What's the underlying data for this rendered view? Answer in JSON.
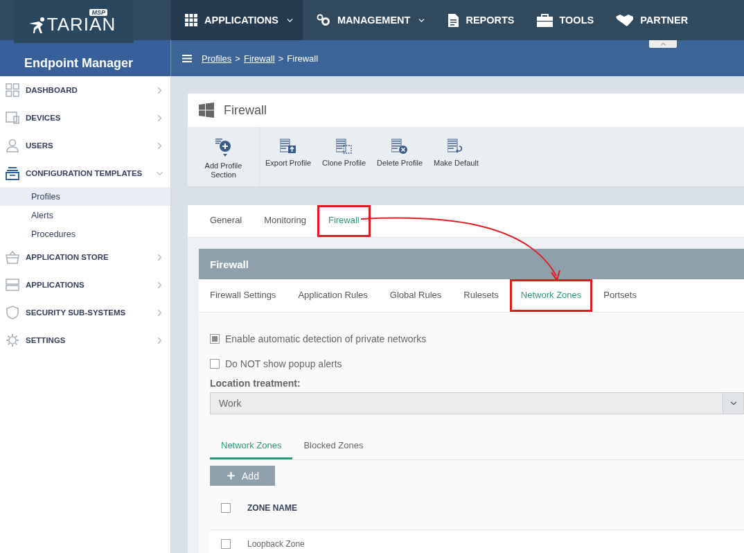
{
  "top_nav": {
    "logo": {
      "name": "TARIAN",
      "badge": "MSP"
    },
    "items": [
      {
        "label": "APPLICATIONS",
        "dropdown": true,
        "selected": true
      },
      {
        "label": "MANAGEMENT",
        "dropdown": true,
        "selected": false
      },
      {
        "label": "REPORTS",
        "dropdown": false,
        "selected": false
      },
      {
        "label": "TOOLS",
        "dropdown": false,
        "selected": false
      },
      {
        "label": "PARTNER",
        "dropdown": false,
        "selected": false
      }
    ]
  },
  "sidebar": {
    "title": "Endpoint Manager",
    "items": [
      {
        "label": "DASHBOARD",
        "expanded": false
      },
      {
        "label": "DEVICES",
        "expanded": false
      },
      {
        "label": "USERS",
        "expanded": false
      },
      {
        "label": "CONFIGURATION TEMPLATES",
        "expanded": true,
        "children": [
          {
            "label": "Profiles",
            "selected": true
          },
          {
            "label": "Alerts",
            "selected": false
          },
          {
            "label": "Procedures",
            "selected": false
          }
        ]
      },
      {
        "label": "APPLICATION STORE",
        "expanded": false
      },
      {
        "label": "APPLICATIONS",
        "expanded": false
      },
      {
        "label": "SECURITY SUB-SYSTEMS",
        "expanded": false
      },
      {
        "label": "SETTINGS",
        "expanded": false
      }
    ]
  },
  "breadcrumb": {
    "separator": ">",
    "items": [
      {
        "label": "Profiles",
        "link": true
      },
      {
        "label": "Firewall",
        "link": true
      },
      {
        "label": "Firewall",
        "link": false
      }
    ]
  },
  "profile": {
    "title": "Firewall",
    "toolbar": [
      "Add Profile Section",
      "Export Profile",
      "Clone Profile",
      "Delete Profile",
      "Make Default"
    ],
    "tabs": [
      {
        "label": "General",
        "selected": false,
        "highlighted": false
      },
      {
        "label": "Monitoring",
        "selected": false,
        "highlighted": false
      },
      {
        "label": "Firewall",
        "selected": true,
        "highlighted": true
      }
    ]
  },
  "section": {
    "title": "Firewall",
    "tabs": [
      {
        "label": "Firewall Settings",
        "selected": false,
        "highlighted": false
      },
      {
        "label": "Application Rules",
        "selected": false,
        "highlighted": false
      },
      {
        "label": "Global Rules",
        "selected": false,
        "highlighted": false
      },
      {
        "label": "Rulesets",
        "selected": false,
        "highlighted": false
      },
      {
        "label": "Network Zones",
        "selected": true,
        "highlighted": true
      },
      {
        "label": "Portsets",
        "selected": false,
        "highlighted": false
      }
    ],
    "options": [
      {
        "label": "Enable automatic detection of private networks",
        "checked": true
      },
      {
        "label": "Do NOT show popup alerts",
        "checked": false
      }
    ],
    "location": {
      "label": "Location treatment:",
      "value": "Work"
    },
    "zone_tabs": [
      {
        "label": "Network Zones",
        "selected": true
      },
      {
        "label": "Blocked Zones",
        "selected": false
      }
    ],
    "add_button": "Add",
    "table": {
      "columns": [
        {
          "label": "ZONE NAME",
          "checked": false
        }
      ],
      "rows": [
        {
          "name": "Loopback Zone",
          "checked": false
        }
      ]
    }
  }
}
